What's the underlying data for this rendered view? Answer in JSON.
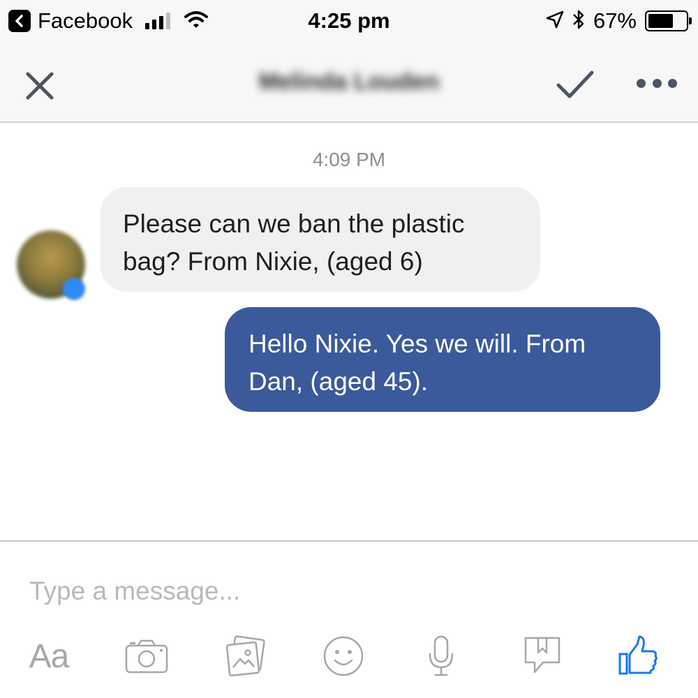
{
  "status_bar": {
    "back_app": "Facebook",
    "time": "4:25 pm",
    "battery_percent": "67%",
    "battery_level": 0.67,
    "signal_bars": 3,
    "signal_max": 4,
    "icons": [
      "back-icon",
      "signal-icon",
      "wifi-icon",
      "location-icon",
      "bluetooth-icon",
      "battery-icon"
    ]
  },
  "header": {
    "title": "Melinda Louden",
    "title_blurred": true,
    "icons": [
      "close-icon",
      "checkmark-icon",
      "more-icon"
    ]
  },
  "conversation": {
    "timestamp": "4:09 PM",
    "messages": [
      {
        "direction": "incoming",
        "text": "Please can we ban the plastic bag? From Nixie, (aged 6)",
        "avatar_blurred": true
      },
      {
        "direction": "outgoing",
        "text": "Hello Nixie. Yes we will. From Dan, (aged 45)."
      }
    ]
  },
  "composer": {
    "placeholder": "Type a message...",
    "value": "",
    "text_style_label": "Aa",
    "tools": [
      "text-style-icon",
      "camera-icon",
      "gallery-icon",
      "emoji-icon",
      "microphone-icon",
      "sticker-icon",
      "like-icon"
    ]
  },
  "colors": {
    "outgoing_bubble": "#3a5a9b",
    "incoming_bubble": "#f1f0f0",
    "like_blue": "#1877f2",
    "icon_gray": "#a6a6ab",
    "header_bg": "#f7f7f7"
  }
}
